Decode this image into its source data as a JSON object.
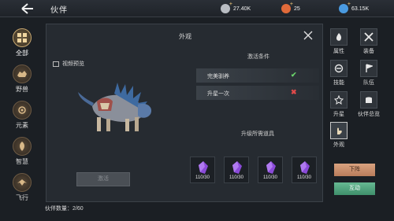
{
  "header": {
    "title": "伙伴",
    "resources": [
      {
        "icon": "coin-icon",
        "value": "27.40K",
        "color": "#b8bcc2"
      },
      {
        "icon": "orange-gem-icon",
        "value": "25",
        "color": "#e06a3a"
      },
      {
        "icon": "blue-gem-icon",
        "value": "63.15K",
        "color": "#4a9ae0"
      }
    ]
  },
  "left_nav": [
    {
      "label": "全部",
      "icon": "grid-icon",
      "active": true
    },
    {
      "label": "野兽",
      "icon": "beast-icon"
    },
    {
      "label": "元素",
      "icon": "element-icon"
    },
    {
      "label": "智慧",
      "icon": "wisdom-icon"
    },
    {
      "label": "飞行",
      "icon": "flight-icon"
    }
  ],
  "dialog": {
    "title": "外观",
    "preview_label": "视频预览",
    "disabled_button": "激活",
    "conditions_header": "激活条件",
    "conditions": [
      {
        "label": "完美驯养",
        "met": true
      },
      {
        "label": "升星一次",
        "met": false
      }
    ],
    "required_header": "升级所需道具",
    "items": [
      {
        "count": "110/30"
      },
      {
        "count": "110/30"
      },
      {
        "count": "110/30"
      },
      {
        "count": "110/30"
      }
    ]
  },
  "partner_count": "伙伴数量：2/60",
  "right_menu": [
    {
      "label": "属性",
      "icon": "flame-icon"
    },
    {
      "label": "装备",
      "icon": "crossed-swords-icon"
    },
    {
      "label": "技能",
      "icon": "skill-icon"
    },
    {
      "label": "队伍",
      "icon": "flag-icon"
    },
    {
      "label": "升星",
      "icon": "star-icon"
    },
    {
      "label": "伙伴总览",
      "icon": "overview-icon"
    },
    {
      "label": "外观",
      "icon": "hand-icon",
      "active": true
    }
  ],
  "actions": {
    "deploy": "下阵",
    "interact": "互动"
  }
}
